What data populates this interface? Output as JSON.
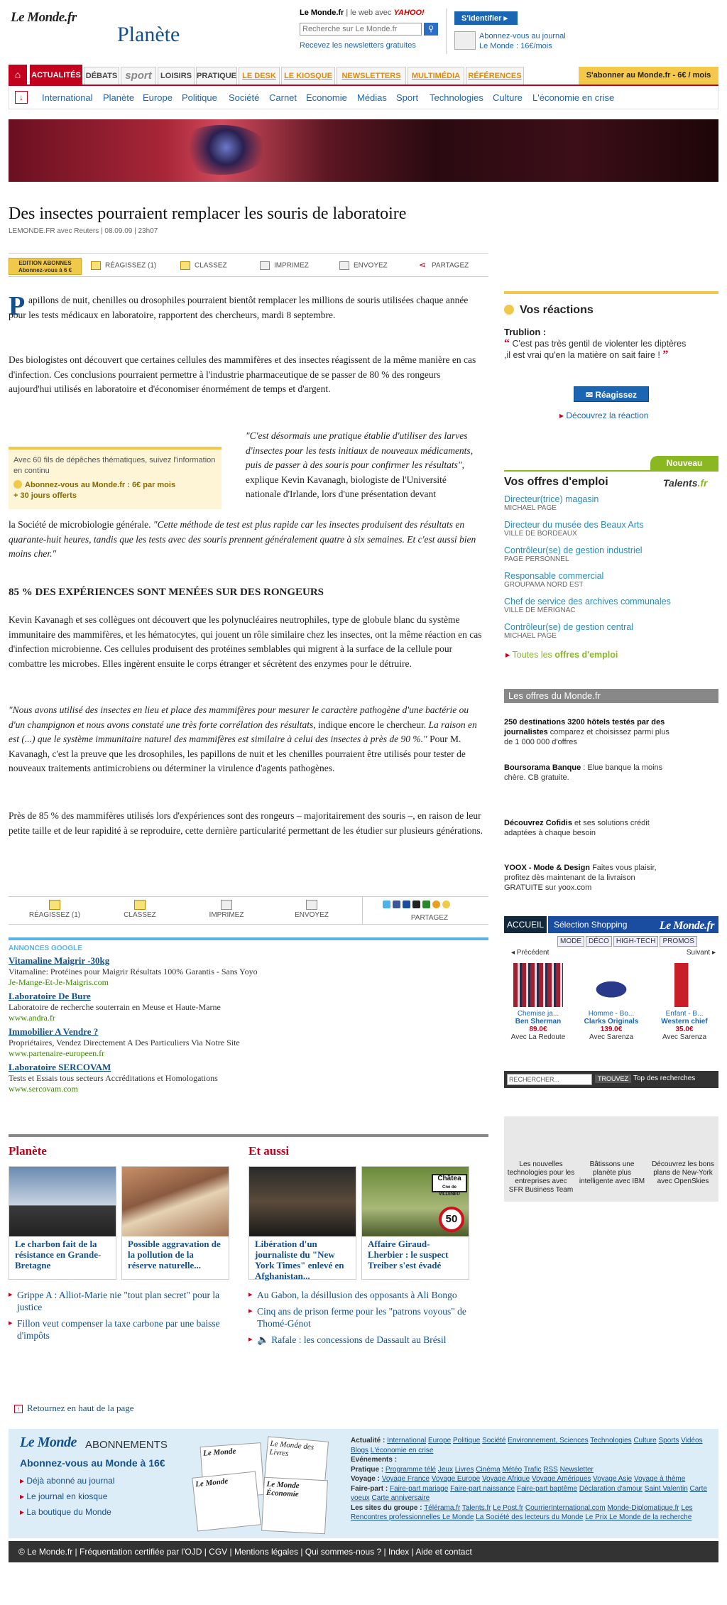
{
  "header": {
    "logo": "Le Monde.fr",
    "section": "Planète",
    "search": {
      "site": "Le Monde.fr",
      "sep": "le web avec",
      "engine": "YAHOO!",
      "placeholder": "Recherche sur Le Monde.fr",
      "newsletter": "Recevez les newsletters gratuites"
    },
    "identify": "S'identifier",
    "subscribe_line1": "Abonnez-vous au journal",
    "subscribe_line2": "Le Monde : 16€/mois"
  },
  "nav": {
    "items": [
      "ACTUALITÉS",
      "DÉBATS",
      "sport",
      "LOISIRS",
      "PRATIQUE",
      "LE DESK",
      "LE KIOSQUE",
      "NEWSLETTERS",
      "MULTIMÉDIA",
      "RÉFÉRENCES"
    ],
    "subscribe": "S'abonner au Monde.fr - 6€ / mois",
    "sub": [
      "International",
      "Planète",
      "Europe",
      "Politique",
      "Société",
      "Carnet",
      "Economie",
      "Médias",
      "Sport",
      "Technologies",
      "Culture",
      "L'économie en crise"
    ]
  },
  "article": {
    "title": "Des insectes pourraient remplacer les souris de laboratoire",
    "byline": "LEMONDE.FR avec Reuters | 08.09.09 | 23h07",
    "toolbar": {
      "edition1": "EDITION ABONNES",
      "edition2": "Abonnez-vous à 6 €",
      "reread": "Réagissez (1)",
      "classify": "Classez",
      "print": "Imprimez",
      "send": "Envoyez",
      "share": "Partagez"
    },
    "dropcap": "P",
    "p1": "apillons de nuit, chenilles ou drosophiles pourraient bientôt remplacer les millions de souris utilisées chaque année pour les tests médicaux en laboratoire, rapportent des chercheurs, mardi 8 septembre.",
    "p2": "Des biologistes ont découvert que certaines cellules des mammifères et des insectes réagissent de la même manière en cas d'infection. Ces conclusions pourraient permettre à l'industrie pharmaceutique de se passer de 80 % des rongeurs aujourd'hui utilisés en laboratoire et d'économiser énormément de temps et d'argent.",
    "q1a": "\"C'est désormais une pratique établie d'utiliser des larves d'insectes pour les tests initiaux de nouveaux médicaments, puis de passer à des souris pour confirmer les résultats\"",
    "q1b": ", explique Kevin Kavanagh, biologiste de l'Université nationale d'Irlande, lors d'une présentation devant",
    "q1c": "la Société de microbiologie générale.",
    "q1d": "\"Cette méthode de test est plus rapide car les insectes produisent des résultats en quarante-huit heures, tandis que les tests avec des souris prennent généralement quatre à six semaines. Et c'est aussi bien moins cher.\"",
    "promo": {
      "line1": "Avec 60 fils de dépêches thématiques, suivez l'information en continu",
      "cta": "Abonnez-vous au Monde.fr : 6€ par mois",
      "extra": "+ 30 jours offerts"
    },
    "h2": "85 % DES EXPÉRIENCES SONT MENÉES SUR DES RONGEURS",
    "p3": "Kevin Kavanagh et ses collègues ont découvert que les polynucléaires neutrophiles, type de globule blanc du système immunitaire des mammifères, et les hématocytes, qui jouent un rôle similaire chez les insectes, ont la même réaction en cas d'infection microbienne. Ces cellules produisent des protéines semblables qui migrent à la surface de la cellule pour combattre les microbes. Elles ingèrent ensuite le corps étranger et sécrètent des enzymes pour le détruire.",
    "p4a": "\"Nous avons utilisé des insectes en lieu et place des mammifères pour mesurer le caractère pathogène d'une bactérie ou d'un champignon et nous avons constaté une très forte corrélation des résultats",
    "p4b": ", indique encore le chercheur.",
    "p4c": "La raison en est (...) que le système immunitaire naturel des mammifères est similaire à celui des insectes à près de 90 %.\"",
    "p4d": "Pour M. Kavanagh, c'est la preuve que les drosophiles, les papillons de nuit et les chenilles pourraient être utilisés pour tester de nouveaux traitements antimicrobiens ou déterminer la virulence d'agents pathogènes.",
    "p5": "Près de 85 % des mammifères utilisés lors d'expériences sont des rongeurs – majoritairement des souris –, en raison de leur petite taille et de leur rapidité à se reproduire, cette dernière particularité permettant de les étudier sur plusieurs générations."
  },
  "bottom_toolbar": {
    "reread": "RÉAGISSEZ (1)",
    "classify": "CLASSEZ",
    "print": "IMPRIMEZ",
    "send": "ENVOYEZ",
    "share": "PARTAGEZ"
  },
  "ads": {
    "heading": "ANNONCES GOOGLE",
    "items": [
      {
        "title": "Vitamaline Maigrir -30kg",
        "desc": "Vitamaline: Protéines pour Maigrir Résultats 100% Garantis - Sans Yoyo",
        "url": "Je-Mange-Et-Je-Maigris.com"
      },
      {
        "title": "Laboratoire De Bure",
        "desc": "Laboratoire de recherche souterrain en Meuse et Haute-Marne",
        "url": "www.andra.fr"
      },
      {
        "title": "Immobilier A Vendre ?",
        "desc": "Propriétaires, Vendez Directement A Des Particuliers Via Notre Site",
        "url": "www.partenaire-europeen.fr"
      },
      {
        "title": "Laboratoire SERCOVAM",
        "desc": "Tests et Essais tous secteurs Accréditations et Homologations",
        "url": "www.sercovam.com"
      }
    ]
  },
  "related": {
    "planete_head": "Planète",
    "aussi_head": "Et aussi",
    "cards": [
      {
        "caption": "Le charbon fait de la résistance en Grande-Bretagne"
      },
      {
        "caption": "Possible aggravation de la pollution de la réserve naturelle..."
      },
      {
        "caption": "Libération d'un journaliste du \"New York Times\" enlevé en Afghanistan..."
      },
      {
        "caption": "Affaire Giraud-Lherbier : le suspect Treiber s'est évadé"
      }
    ],
    "planete_links": [
      "Grippe A : Alliot-Marie nie \"tout plan secret\" pour la justice",
      "Fillon veut compenser la taxe carbone par une baisse d'impôts"
    ],
    "aussi_links": [
      "Au Gabon, la désillusion des opposants à Ali Bongo",
      "Cinq ans de prison ferme pour les \"patrons voyous\" de Thomé-Génot",
      "Rafale : les concessions de Dassault au Brésil"
    ],
    "sign_text": "Châtea",
    "sign_text2": "Cne de VILLENEU",
    "sign_speed": "50"
  },
  "back_top": "Retournez en haut de la page",
  "footer": {
    "logo": "Le Monde",
    "abon_title": "ABONNEMENTS",
    "abon_price": "Abonnez-vous au Monde à 16€",
    "abon_links": [
      "Déjà abonné au journal",
      "Le journal en kiosque",
      "La boutique du Monde"
    ],
    "covers": [
      "Le Monde",
      "Le Monde des Livres",
      "Le Monde",
      "Le Monde Économie"
    ],
    "links_html_rows": [
      {
        "label": "Actualité :",
        "links": [
          "International",
          "Europe",
          "Politique",
          "Société",
          "Environnement, Sciences",
          "Technologies",
          "Culture",
          "Sports",
          "Vidéos",
          "Blogs",
          "L'économie en crise"
        ]
      },
      {
        "label": "Evénements :",
        "links": []
      },
      {
        "label": "Pratique :",
        "links": [
          "Programme télé",
          "Jeux",
          "Livres",
          "Cinéma",
          "Météo",
          "Trafic",
          "RSS",
          "Newsletter"
        ]
      },
      {
        "label": "Voyage :",
        "links": [
          "Voyage France",
          "Voyage Europe",
          "Voyage Afrique",
          "Voyage Amériques",
          "Voyage Asie",
          "Voyage à thème"
        ]
      },
      {
        "label": "Faire-part :",
        "links": [
          "Faire-part mariage",
          "Faire-part naissance",
          "Faire-part baptême",
          "Déclaration d'amour",
          "Saint Valentin",
          "Carte voeux",
          "Carte anniversaire"
        ]
      },
      {
        "label": "Les sites du groupe :",
        "links": [
          "Télérama.fr",
          "Talents.fr",
          "Le Post.fr",
          "CourrierInternational.com",
          "Monde-Diplomatique.fr",
          "Les Rencontres professionnelles Le Monde",
          "La Société des lecteurs du Monde",
          "Le Prix Le Monde de la recherche"
        ]
      }
    ],
    "bar": "© Le Monde.fr | Fréquentation certifiée par l'OJD | CGV | Mentions légales | Qui sommes-nous ? | Index | Aide et contact"
  },
  "reactions": {
    "title": "Vos réactions",
    "who": "Trublion :",
    "quote": "C'est pas très gentil de violenter les diptères ,il est vrai qu'en la matière on sait faire !",
    "button": "Réagissez",
    "discover": "Découvrez la réaction"
  },
  "jobs": {
    "badge": "Nouveau",
    "title": "Vos offres d'emploi",
    "brand": "Talents",
    "brand_tld": ".fr",
    "items": [
      {
        "t": "Directeur(trice) magasin",
        "s": "MICHAEL PAGE"
      },
      {
        "t": "Directeur du musée des Beaux Arts",
        "s": "VILLE DE BORDEAUX"
      },
      {
        "t": "Contrôleur(se) de gestion industriel",
        "s": "PAGE PERSONNEL"
      },
      {
        "t": "Responsable commercial",
        "s": "GROUPAMA NORD EST"
      },
      {
        "t": "Chef de service des archives communales",
        "s": "VILLE DE MÉRIGNAC"
      },
      {
        "t": "Contrôleur(se) de gestion central",
        "s": "MICHAEL PAGE"
      }
    ],
    "all_a": "Toutes les ",
    "all_b": "offres d'emploi"
  },
  "offers": {
    "heading": "Les offres du Monde.fr",
    "items": [
      {
        "b": "250 destinations 3200 hôtels testés par des journalistes",
        "t": " comparez et choisissez parmi plus de 1 000 000 d'offres"
      },
      {
        "b": "Boursorama Banque",
        "t": " : Elue banque la moins chère. CB gratuite."
      },
      {
        "b": "Découvrez Cofidis",
        "t": " et ses solutions crédit adaptées à chaque besoin"
      },
      {
        "b": "YOOX - Mode & Design",
        "t": " Faites vous plaisir, profitez dès maintenant de la livraison GRATUITE sur yoox.com"
      }
    ]
  },
  "shop": {
    "tab_a": "ACCUEIL",
    "tab_b": "Sélection Shopping",
    "logo": "Le Monde.fr",
    "cats": [
      "MODE",
      "DÉCO",
      "HIGH-TECH",
      "PROMOS"
    ],
    "prev": "◂ Précédent",
    "next": "Suivant ▸",
    "products": [
      {
        "n": "Chemise ja...",
        "b": "Ben Sherman",
        "p": "89.0€",
        "m": "Avec La Redoute"
      },
      {
        "n": "Homme - Bo...",
        "b": "Clarks Originals",
        "p": "139.0€",
        "m": "Avec Sarenza"
      },
      {
        "n": "Enfant - B...",
        "b": "Western chief",
        "p": "35.0€",
        "m": "Avec Sarenza"
      }
    ],
    "search_placeholder": "RECHERCHER...",
    "search_btn": "TROUVEZ",
    "top": "Top des recherches"
  },
  "promo3": [
    "Les nouvelles technologies pour les entreprises avec SFR Business Team",
    "Bâtissons une planète plus intelligente avec IBM",
    "Découvrez les bons plans de New-York avec OpenSkies"
  ]
}
